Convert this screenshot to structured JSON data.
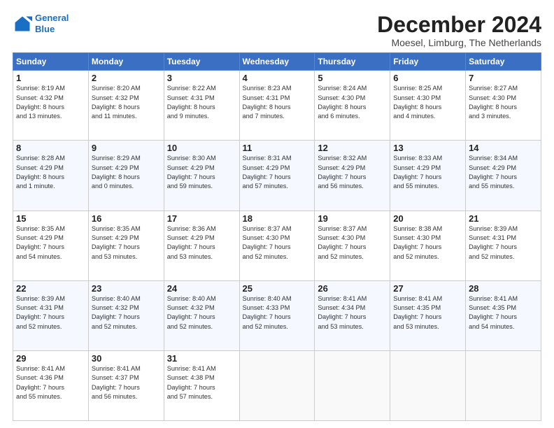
{
  "logo": {
    "line1": "General",
    "line2": "Blue"
  },
  "title": "December 2024",
  "subtitle": "Moesel, Limburg, The Netherlands",
  "header_days": [
    "Sunday",
    "Monday",
    "Tuesday",
    "Wednesday",
    "Thursday",
    "Friday",
    "Saturday"
  ],
  "weeks": [
    [
      {
        "day": "1",
        "detail": "Sunrise: 8:19 AM\nSunset: 4:32 PM\nDaylight: 8 hours\nand 13 minutes."
      },
      {
        "day": "2",
        "detail": "Sunrise: 8:20 AM\nSunset: 4:32 PM\nDaylight: 8 hours\nand 11 minutes."
      },
      {
        "day": "3",
        "detail": "Sunrise: 8:22 AM\nSunset: 4:31 PM\nDaylight: 8 hours\nand 9 minutes."
      },
      {
        "day": "4",
        "detail": "Sunrise: 8:23 AM\nSunset: 4:31 PM\nDaylight: 8 hours\nand 7 minutes."
      },
      {
        "day": "5",
        "detail": "Sunrise: 8:24 AM\nSunset: 4:30 PM\nDaylight: 8 hours\nand 6 minutes."
      },
      {
        "day": "6",
        "detail": "Sunrise: 8:25 AM\nSunset: 4:30 PM\nDaylight: 8 hours\nand 4 minutes."
      },
      {
        "day": "7",
        "detail": "Sunrise: 8:27 AM\nSunset: 4:30 PM\nDaylight: 8 hours\nand 3 minutes."
      }
    ],
    [
      {
        "day": "8",
        "detail": "Sunrise: 8:28 AM\nSunset: 4:29 PM\nDaylight: 8 hours\nand 1 minute."
      },
      {
        "day": "9",
        "detail": "Sunrise: 8:29 AM\nSunset: 4:29 PM\nDaylight: 8 hours\nand 0 minutes."
      },
      {
        "day": "10",
        "detail": "Sunrise: 8:30 AM\nSunset: 4:29 PM\nDaylight: 7 hours\nand 59 minutes."
      },
      {
        "day": "11",
        "detail": "Sunrise: 8:31 AM\nSunset: 4:29 PM\nDaylight: 7 hours\nand 57 minutes."
      },
      {
        "day": "12",
        "detail": "Sunrise: 8:32 AM\nSunset: 4:29 PM\nDaylight: 7 hours\nand 56 minutes."
      },
      {
        "day": "13",
        "detail": "Sunrise: 8:33 AM\nSunset: 4:29 PM\nDaylight: 7 hours\nand 55 minutes."
      },
      {
        "day": "14",
        "detail": "Sunrise: 8:34 AM\nSunset: 4:29 PM\nDaylight: 7 hours\nand 55 minutes."
      }
    ],
    [
      {
        "day": "15",
        "detail": "Sunrise: 8:35 AM\nSunset: 4:29 PM\nDaylight: 7 hours\nand 54 minutes."
      },
      {
        "day": "16",
        "detail": "Sunrise: 8:35 AM\nSunset: 4:29 PM\nDaylight: 7 hours\nand 53 minutes."
      },
      {
        "day": "17",
        "detail": "Sunrise: 8:36 AM\nSunset: 4:29 PM\nDaylight: 7 hours\nand 53 minutes."
      },
      {
        "day": "18",
        "detail": "Sunrise: 8:37 AM\nSunset: 4:30 PM\nDaylight: 7 hours\nand 52 minutes."
      },
      {
        "day": "19",
        "detail": "Sunrise: 8:37 AM\nSunset: 4:30 PM\nDaylight: 7 hours\nand 52 minutes."
      },
      {
        "day": "20",
        "detail": "Sunrise: 8:38 AM\nSunset: 4:30 PM\nDaylight: 7 hours\nand 52 minutes."
      },
      {
        "day": "21",
        "detail": "Sunrise: 8:39 AM\nSunset: 4:31 PM\nDaylight: 7 hours\nand 52 minutes."
      }
    ],
    [
      {
        "day": "22",
        "detail": "Sunrise: 8:39 AM\nSunset: 4:31 PM\nDaylight: 7 hours\nand 52 minutes."
      },
      {
        "day": "23",
        "detail": "Sunrise: 8:40 AM\nSunset: 4:32 PM\nDaylight: 7 hours\nand 52 minutes."
      },
      {
        "day": "24",
        "detail": "Sunrise: 8:40 AM\nSunset: 4:32 PM\nDaylight: 7 hours\nand 52 minutes."
      },
      {
        "day": "25",
        "detail": "Sunrise: 8:40 AM\nSunset: 4:33 PM\nDaylight: 7 hours\nand 52 minutes."
      },
      {
        "day": "26",
        "detail": "Sunrise: 8:41 AM\nSunset: 4:34 PM\nDaylight: 7 hours\nand 53 minutes."
      },
      {
        "day": "27",
        "detail": "Sunrise: 8:41 AM\nSunset: 4:35 PM\nDaylight: 7 hours\nand 53 minutes."
      },
      {
        "day": "28",
        "detail": "Sunrise: 8:41 AM\nSunset: 4:35 PM\nDaylight: 7 hours\nand 54 minutes."
      }
    ],
    [
      {
        "day": "29",
        "detail": "Sunrise: 8:41 AM\nSunset: 4:36 PM\nDaylight: 7 hours\nand 55 minutes."
      },
      {
        "day": "30",
        "detail": "Sunrise: 8:41 AM\nSunset: 4:37 PM\nDaylight: 7 hours\nand 56 minutes."
      },
      {
        "day": "31",
        "detail": "Sunrise: 8:41 AM\nSunset: 4:38 PM\nDaylight: 7 hours\nand 57 minutes."
      },
      {
        "day": "",
        "detail": ""
      },
      {
        "day": "",
        "detail": ""
      },
      {
        "day": "",
        "detail": ""
      },
      {
        "day": "",
        "detail": ""
      }
    ]
  ]
}
